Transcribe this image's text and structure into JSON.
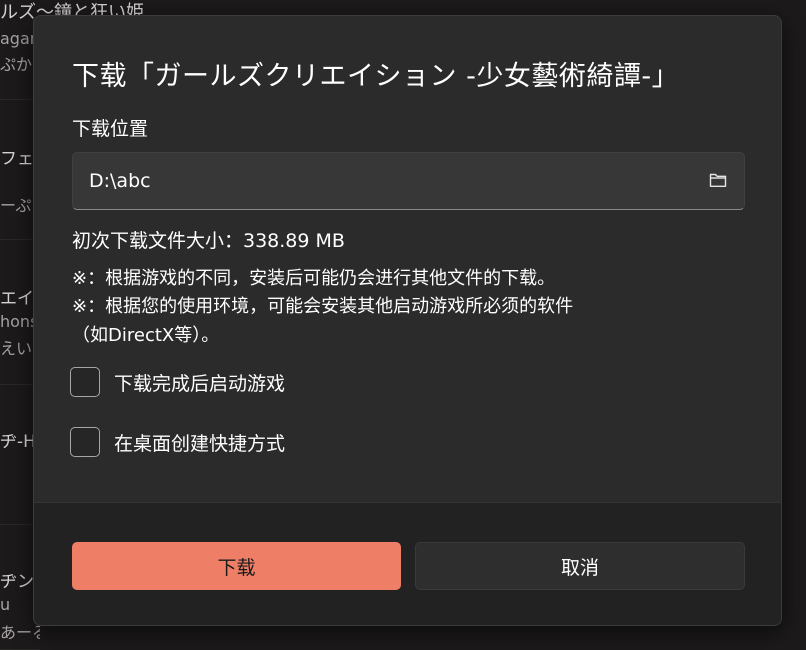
{
  "background": {
    "top_title": "ルズ〜鐘と狂い姫",
    "rows": [
      {
        "line1": "agam",
        "line2": "ぷかか"
      },
      {
        "line1": "フェー",
        "line2": "ーぷ"
      },
      {
        "line1": "エイ",
        "line2": "hons",
        "line3": "えいし"
      },
      {
        "line1": "ヂ-HA"
      },
      {
        "line1": "ヂンR",
        "line2": "u",
        "line3": "あーる"
      }
    ]
  },
  "dialog": {
    "title": "下载「ガールズクリエイション -少女藝術綺譚-」",
    "location_label": "下载位置",
    "path_value": "D:\\abc",
    "path_icon": "folder-icon",
    "size_text": "初次下载文件大小：338.89 MB",
    "notes": [
      "※：根据游戏的不同，安装后可能仍会进行其他文件的下载。",
      "※：根据您的使用环境，可能会安装其他启动游戏所必须的软件",
      "（如DirectX等）。"
    ],
    "checkboxes": [
      {
        "label": "下载完成后启动游戏",
        "checked": false
      },
      {
        "label": "在桌面创建快捷方式",
        "checked": false
      }
    ],
    "buttons": {
      "download": "下载",
      "cancel": "取消"
    }
  },
  "colors": {
    "accent": "#ef7e67",
    "dialog_bg": "#2b2b2b",
    "footer_bg": "#222222"
  }
}
